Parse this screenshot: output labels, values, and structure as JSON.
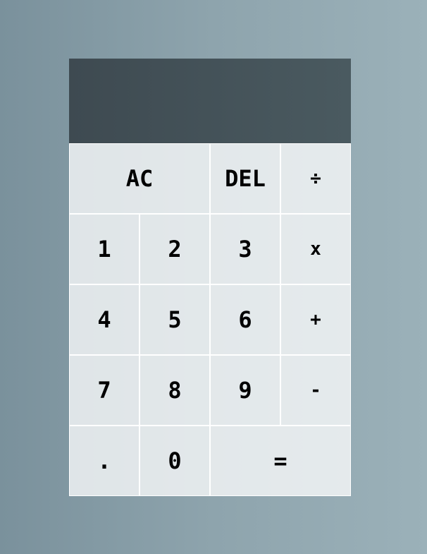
{
  "display": {
    "previous_operand": "",
    "current_operand": ""
  },
  "buttons": {
    "all_clear": "AC",
    "delete": "DEL",
    "divide": "÷",
    "one": "1",
    "two": "2",
    "three": "3",
    "multiply": "x",
    "four": "4",
    "five": "5",
    "six": "6",
    "add": "+",
    "seven": "7",
    "eight": "8",
    "nine": "9",
    "subtract": "-",
    "decimal": ".",
    "zero": "0",
    "equals": "="
  }
}
